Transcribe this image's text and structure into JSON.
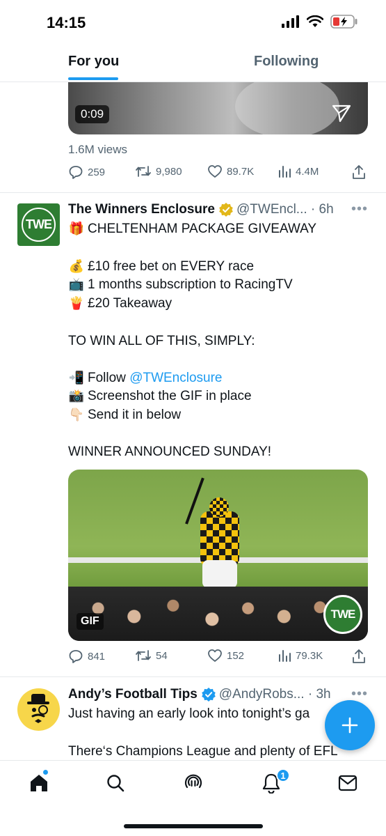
{
  "status_bar": {
    "time": "14:15"
  },
  "top_tabs": {
    "for_you": "For you",
    "following": "Following"
  },
  "prev_tweet": {
    "video_duration": "0:09",
    "views": "1.6M views",
    "replies": "259",
    "reposts": "9,980",
    "likes": "89.7K",
    "view_count": "4.4M"
  },
  "tweet1": {
    "display_name": "The Winners Enclosure",
    "handle_time": "@TWEncl... · 6h",
    "avatar_text": "TWE",
    "lines": [
      {
        "emoji": "🎁",
        "text": "CHELTENHAM PACKAGE GIVEAWAY"
      },
      {
        "emoji": "💰",
        "text": "£10 free bet on EVERY race"
      },
      {
        "emoji": "📺",
        "text": "1 months subscription to RacingTV"
      },
      {
        "emoji": "🍟",
        "text": "£20 Takeaway"
      },
      {
        "emoji": "",
        "text": "TO WIN ALL OF THIS, SIMPLY:"
      },
      {
        "emoji": "📲",
        "text": "Follow ",
        "link": "@TWEnclosure"
      },
      {
        "emoji": "📸",
        "text": "Screenshot the GIF in place"
      },
      {
        "emoji": "👇🏻",
        "text": "Send it in below"
      },
      {
        "emoji": "",
        "text": "WINNER ANNOUNCED SUNDAY!"
      }
    ],
    "gif_label": "GIF",
    "gif_logo": "TWE",
    "replies": "841",
    "reposts": "54",
    "likes": "152",
    "view_count": "79.3K"
  },
  "tweet2": {
    "display_name": "Andy’s Football Tips",
    "handle_time": "@AndyRobs... · 3h",
    "line1": "Just having an early look into tonight’s ga",
    "line2": "There‘s Champions League and plenty of EFL"
  },
  "bottom_nav": {
    "notifications_badge": "1"
  },
  "colors": {
    "accent": "#1d9bf0",
    "secondary_text": "#536471",
    "twe_green": "#2e7d32",
    "verified_gold": "#e2b719"
  },
  "icons": [
    "signal-icon",
    "wifi-icon",
    "battery-icon",
    "send-icon",
    "reply-icon",
    "repost-icon",
    "like-icon",
    "views-icon",
    "share-icon",
    "verified-gold-icon",
    "verified-blue-icon",
    "compose-icon",
    "home-icon",
    "search-icon",
    "spaces-icon",
    "notifications-icon",
    "messages-icon"
  ]
}
